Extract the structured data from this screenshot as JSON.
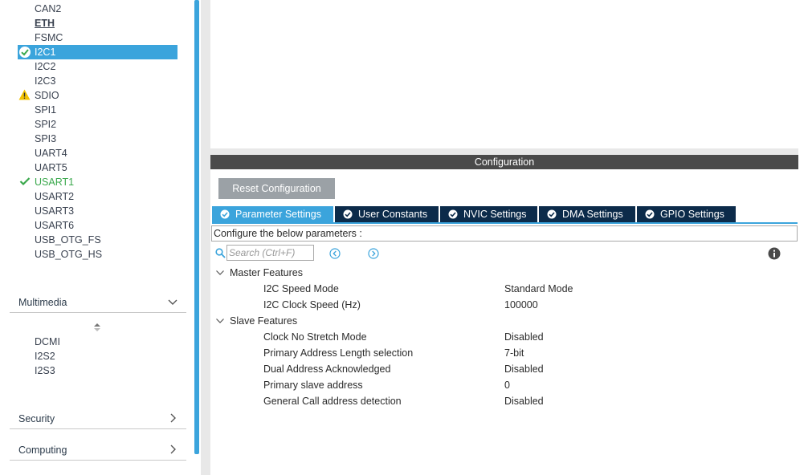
{
  "sidebar": {
    "peripherals": [
      {
        "label": "CAN2",
        "status": "none"
      },
      {
        "label": "ETH",
        "status": "underlined"
      },
      {
        "label": "FSMC",
        "status": "none"
      },
      {
        "label": "I2C1",
        "status": "selected-ok"
      },
      {
        "label": "I2C2",
        "status": "none"
      },
      {
        "label": "I2C3",
        "status": "none"
      },
      {
        "label": "SDIO",
        "status": "warning"
      },
      {
        "label": "SPI1",
        "status": "none"
      },
      {
        "label": "SPI2",
        "status": "none"
      },
      {
        "label": "SPI3",
        "status": "none"
      },
      {
        "label": "UART4",
        "status": "none"
      },
      {
        "label": "UART5",
        "status": "none"
      },
      {
        "label": "USART1",
        "status": "ok"
      },
      {
        "label": "USART2",
        "status": "none"
      },
      {
        "label": "USART3",
        "status": "none"
      },
      {
        "label": "USART6",
        "status": "none"
      },
      {
        "label": "USB_OTG_FS",
        "status": "none"
      },
      {
        "label": "USB_OTG_HS",
        "status": "none"
      }
    ],
    "multimedia": {
      "label": "Multimedia",
      "items": [
        "DCMI",
        "I2S2",
        "I2S3"
      ]
    },
    "security": {
      "label": "Security"
    },
    "computing": {
      "label": "Computing"
    }
  },
  "config": {
    "title": "Configuration",
    "reset_label": "Reset Configuration",
    "tabs": [
      {
        "label": "Parameter Settings",
        "active": true
      },
      {
        "label": "User Constants",
        "active": false
      },
      {
        "label": "NVIC Settings",
        "active": false
      },
      {
        "label": "DMA Settings",
        "active": false
      },
      {
        "label": "GPIO Settings",
        "active": false
      }
    ],
    "description": "Configure the below parameters :",
    "search_placeholder": "Search (Ctrl+F)",
    "groups": [
      {
        "label": "Master Features",
        "params": [
          {
            "name": "I2C Speed Mode",
            "value": "Standard Mode"
          },
          {
            "name": "I2C Clock Speed (Hz)",
            "value": "100000"
          }
        ]
      },
      {
        "label": "Slave Features",
        "params": [
          {
            "name": "Clock No Stretch Mode",
            "value": "Disabled"
          },
          {
            "name": "Primary Address Length selection",
            "value": "7-bit"
          },
          {
            "name": "Dual Address Acknowledged",
            "value": "Disabled"
          },
          {
            "name": "Primary slave address",
            "value": "0"
          },
          {
            "name": "General Call address detection",
            "value": "Disabled"
          }
        ]
      }
    ]
  },
  "colors": {
    "accent": "#3ba4dc",
    "tab_dark": "#0c2b4a",
    "ok_green": "#3aa84c",
    "warning_yellow": "#f2c200",
    "header_dark": "#4a4a4a"
  }
}
